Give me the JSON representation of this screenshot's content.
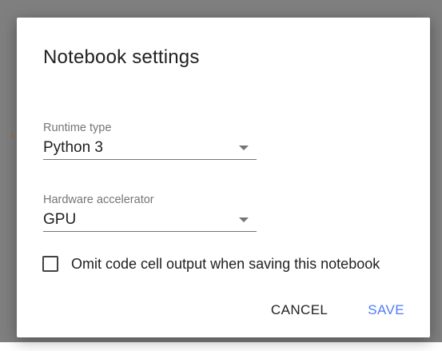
{
  "backdrop": {
    "fragment": "1"
  },
  "dialog": {
    "title": "Notebook settings",
    "runtime": {
      "label": "Runtime type",
      "value": "Python 3"
    },
    "accelerator": {
      "label": "Hardware accelerator",
      "value": "GPU"
    },
    "omit_output": {
      "label": "Omit code cell output when saving this notebook",
      "checked": false
    },
    "actions": {
      "cancel_label": "CANCEL",
      "save_label": "SAVE"
    }
  },
  "colors": {
    "accent": "#4f7cf7",
    "overlay": "#7f7f7f",
    "text_primary": "#212121",
    "text_secondary": "#757575"
  },
  "icons": {
    "select_caret": "chevron-down-icon",
    "checkbox": "checkbox-unchecked-icon"
  }
}
